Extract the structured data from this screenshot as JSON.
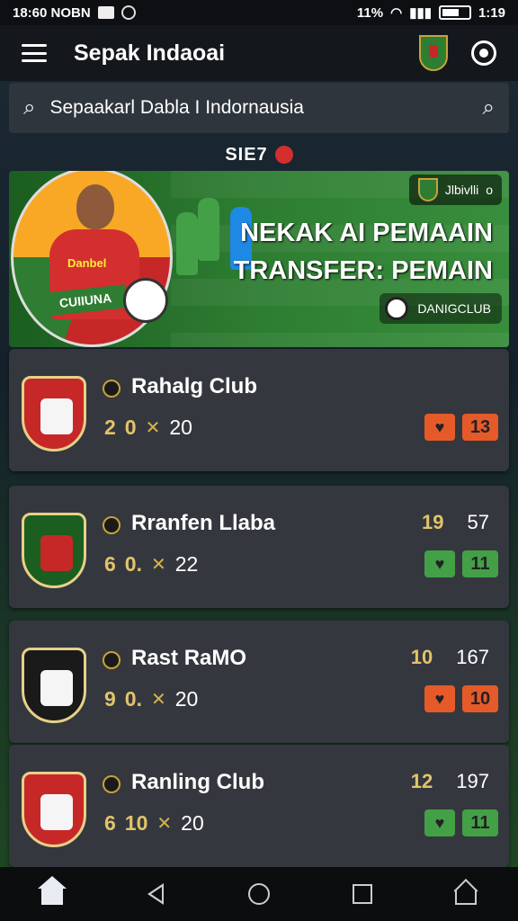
{
  "status_bar": {
    "time": "18:60 NOBN",
    "battery": "11%",
    "clock": "1:19"
  },
  "app_bar": {
    "title": "Sepak Indaoai"
  },
  "search": {
    "value": "Sepaakarl Dabla I Indornausia"
  },
  "badge": {
    "text": "SIE7"
  },
  "banner": {
    "pill_text": "Jlbivlli",
    "pill_symbol": "o",
    "title_line1": "NEKAK AI PEMAAIN",
    "title_line2": "TRANSFER: PEMAIN",
    "club_label": "DANIGCLUB",
    "player_label": "CUIIUNA",
    "shirt_text": "Danbel"
  },
  "clubs": [
    {
      "name": "Rahalg Club",
      "stat1": "2",
      "stat2": "0",
      "stat3": "20",
      "top_left": "",
      "top_right": "",
      "count": "13",
      "tone": "#e65a2a",
      "crest_color": "#c62828"
    },
    {
      "name": "Rranfen Llaba",
      "stat1": "6",
      "stat2": "0.",
      "stat3": "22",
      "top_left": "19",
      "top_right": "57",
      "count": "11",
      "tone": "#43a047",
      "crest_color": "#1b5e20"
    },
    {
      "name": "Rast RaMO",
      "stat1": "9",
      "stat2": "0.",
      "stat3": "20",
      "top_left": "10",
      "top_right": "167",
      "count": "10",
      "tone": "#e65a2a",
      "crest_color": "#1a1a1a"
    },
    {
      "name": "Ranling Club",
      "stat1": "6",
      "stat2": "10",
      "stat3": "20",
      "top_left": "12",
      "top_right": "197",
      "count": "11",
      "tone": "#43a047",
      "crest_color": "#c62828"
    }
  ],
  "colors": {
    "accent_gold": "#e3c36a",
    "orange": "#e65a2a",
    "green": "#43a047"
  }
}
